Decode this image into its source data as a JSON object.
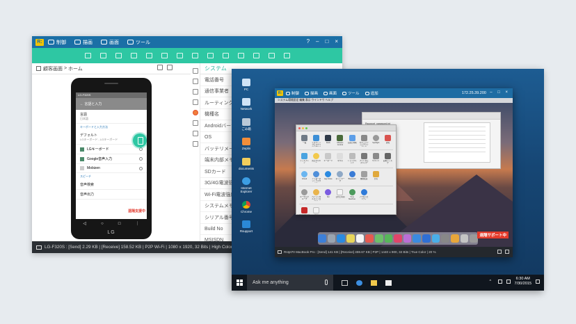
{
  "android_window": {
    "menu": [
      "制御",
      "描画",
      "画面",
      "ツール"
    ],
    "win_buttons": [
      "?",
      "–",
      "□",
      "×"
    ],
    "breadcrumb": [
      "顧客画面",
      "ホーム"
    ],
    "phone": {
      "status_text": "LG-F320S",
      "header": "言語と入力",
      "rows": [
        {
          "title": "言語",
          "sub": "日本語"
        }
      ],
      "section_keyboard": "キーボードと入力方法",
      "default_item": {
        "title": "デフォルト",
        "sub": "LGキーボード - LGキーボード"
      },
      "items": [
        {
          "title": "LGキーボード",
          "sub": "LGキーボード"
        },
        {
          "title": "Google音声入力",
          "sub": ""
        },
        {
          "title": "Mobizen",
          "sub": ""
        }
      ],
      "section_speech": "スピーチ",
      "speech_items": [
        "音声検索",
        "音声出力"
      ],
      "red_label": "遠隔支援中",
      "brand": "LG",
      "nav": [
        "◁",
        "○",
        "□",
        "⋮"
      ]
    },
    "panel_title": "システム",
    "panel_rows": [
      "電話番号",
      "通信事業者",
      "ルーティング",
      "機種名",
      "Androidバージ",
      "OS",
      "バッテリメータ",
      "端末内部メモリ",
      "SDカード",
      "3G/4G電波強度",
      "Wi-Fi電波強度",
      "システムメモリ",
      "シリアル番号",
      "Build No",
      "MSISDN"
    ],
    "status_text": "LG-F320S : [Send] 2.29 KB | [Receive] 158.52 KB | P2P Wi-Fi | 1080 x 1920, 32 Bits | High Color | 20 %"
  },
  "desktop_window": {
    "icons": [
      "PC",
      "Network",
      "ごみ箱",
      "Zeplin",
      "documents",
      "Internet Explorer",
      "Chrome",
      "Rsupport"
    ],
    "taskbar": {
      "search_placeholder": "Ask me anything",
      "time": "6:30 AM",
      "date": "7/30/2015"
    },
    "mac_viewer": {
      "menu": [
        "制御",
        "描画",
        "画面",
        "ツール",
        "追加"
      ],
      "ip": "172.25.39.200",
      "win_buttons": "– □ ×",
      "mac_menubar": "システム環境設定  編集  表示  ウインドウ  ヘルプ",
      "finder_items": [
        "Rsupport_password.txt",
        "Activity.log",
        "Schedule.log"
      ],
      "prefs_row1": [
        "一般",
        "デスクトップとスクリーンセーバ",
        "Dock",
        "Mission Control",
        "言語と地域",
        "セキュリティとプライバシー",
        "Spotlight",
        "通知"
      ],
      "prefs_row2": [
        "ディスプレイ",
        "省エネルギー",
        "キーボード",
        "マウス",
        "トラックパッド",
        "プリンタとスキャナ",
        "サウンド",
        "起動ディスク"
      ],
      "prefs_row3": [
        "iCloud",
        "インターネットアカウント",
        "App Store",
        "ネットワーク",
        "Bluetooth",
        "機能拡張",
        "共有",
        ""
      ],
      "prefs_row4": [
        "ユーザとグループ",
        "ペアレンタルコントロール",
        "Siri",
        "日付と時刻",
        "Time Machine",
        "アクセシビリティ",
        "",
        ""
      ],
      "prefs_row5": [
        "Flash Player",
        "Java",
        "",
        "",
        "",
        "",
        "",
        ""
      ],
      "red_label": "遠隔サポート中",
      "status_text": "RsIpt70 MacBook Pro : [Send] 141 KB | [Receive] 459.67 KB | P2P | 1440 x 900, 32 Bits | True Color | 20 %"
    }
  },
  "colors": {
    "accent_teal": "#2ec7a3",
    "title_blue": "#1b6fa6",
    "status_red": "#e43b2b"
  }
}
